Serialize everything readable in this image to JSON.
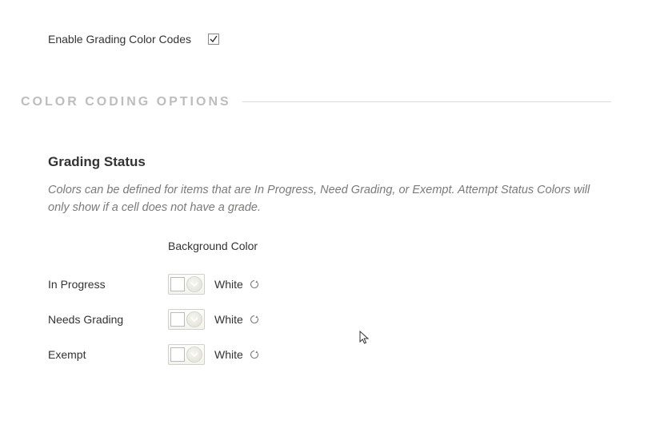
{
  "enable": {
    "label": "Enable Grading Color Codes",
    "checked": true
  },
  "section": {
    "title": "COLOR CODING OPTIONS"
  },
  "grading": {
    "heading": "Grading Status",
    "description": "Colors can be defined for items that are In Progress, Need Grading, or Exempt. Attempt Status Colors will only show if a cell does not have a grade.",
    "column_header": "Background Color",
    "rows": [
      {
        "label": "In Progress",
        "color_name": "White",
        "swatch_hex": "#ffffff"
      },
      {
        "label": "Needs Grading",
        "color_name": "White",
        "swatch_hex": "#ffffff"
      },
      {
        "label": "Exempt",
        "color_name": "White",
        "swatch_hex": "#ffffff"
      }
    ]
  }
}
